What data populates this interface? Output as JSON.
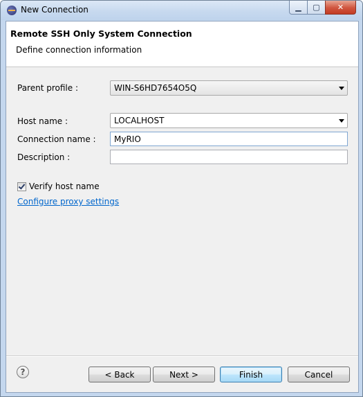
{
  "window": {
    "title": "New Connection"
  },
  "header": {
    "title": "Remote SSH Only System Connection",
    "subtitle": "Define connection information"
  },
  "form": {
    "parent_profile_label": "Parent profile :",
    "parent_profile_value": "WIN-S6HD7654O5Q",
    "host_name_label": "Host name :",
    "host_name_value": "LOCALHOST",
    "connection_name_label": "Connection name :",
    "connection_name_value": "MyRIO",
    "description_label": "Description :",
    "description_value": "",
    "verify_host_label": "Verify host name",
    "verify_host_checked": true,
    "proxy_link": "Configure proxy settings"
  },
  "buttons": {
    "help": "?",
    "back": "< Back",
    "next": "Next >",
    "finish": "Finish",
    "cancel": "Cancel"
  },
  "icons": {
    "app": "eclipse-icon",
    "minimize": "minimize-icon",
    "maximize": "maximize-icon",
    "close": "close-icon",
    "help": "help-icon"
  }
}
